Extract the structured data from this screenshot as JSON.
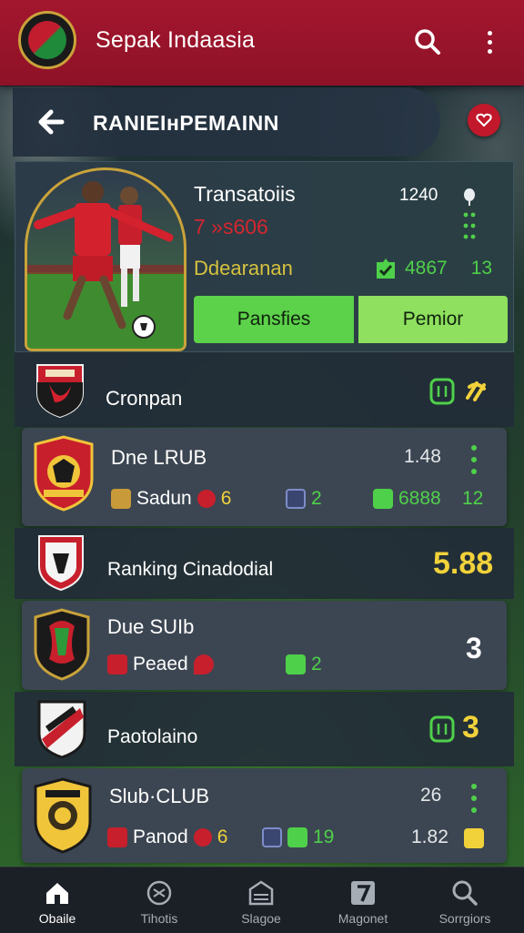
{
  "app_bar": {
    "title": "Sepak Indaasia",
    "search_icon": "search-icon",
    "more_icon": "more-vertical-icon"
  },
  "section": {
    "title": "RANIEIнPEMAINN",
    "back_icon": "arrow-left-icon",
    "notify_icon": "heart-badge-icon"
  },
  "featured": {
    "name": "Transatoiis",
    "subtitle": "7 »s606",
    "label": "Ddearanan",
    "count": "1240",
    "stat_value": "4867",
    "stat_value2": "13",
    "primary_button": "Pansfies",
    "secondary_button": "Pemior"
  },
  "rows": [
    {
      "kind": "plain",
      "title": "Cronpan"
    },
    {
      "kind": "card",
      "title": "Dne LRUB",
      "count": "1.48",
      "chip1": "Sadun",
      "chip1_num": "6",
      "chip2": "2",
      "chip3": "6888",
      "chip4": "12"
    },
    {
      "kind": "plain",
      "title": "Ranking Cinadodial",
      "value": "5.88"
    },
    {
      "kind": "card",
      "title": "Due SUIb",
      "chip1": "Peaed",
      "chip2": "2",
      "value": "3"
    },
    {
      "kind": "plain",
      "title": "Paotolaino",
      "value": "3"
    },
    {
      "kind": "card",
      "title": "Slub·CLUB",
      "count": "26",
      "chip1": "Panod",
      "chip1_num": "6",
      "chip2": "19",
      "value": "1.82"
    }
  ],
  "bottom_nav": [
    {
      "label": "Obaile",
      "icon": "home-icon",
      "active": true
    },
    {
      "label": "Tihotis",
      "icon": "football-icon",
      "active": false
    },
    {
      "label": "Slagoe",
      "icon": "stadium-icon",
      "active": false
    },
    {
      "label": "Magonet",
      "icon": "number-7-icon",
      "active": false
    },
    {
      "label": "Sorrgiors",
      "icon": "search-icon",
      "active": false
    }
  ],
  "colors": {
    "brand_red": "#a3162e",
    "accent_green": "#5cd14a",
    "accent_yellow": "#f1d23a",
    "card_bg": "#3c4652"
  }
}
